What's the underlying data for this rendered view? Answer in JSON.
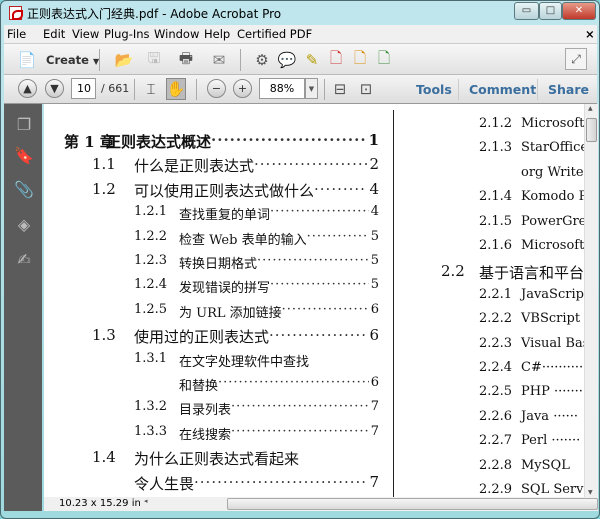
{
  "window": {
    "title": "正则表达式入门经典.pdf - Adobe Acrobat Pro"
  },
  "menu": [
    "File",
    "Edit",
    "View",
    "Plug-Ins",
    "Window",
    "Help",
    "Certified PDF"
  ],
  "toolbar": {
    "create_label": "Create"
  },
  "nav": {
    "page_current": "10",
    "page_total": "/ 661",
    "zoom": "88%",
    "tools": "Tools",
    "comment": "Comment",
    "share": "Share"
  },
  "status": {
    "page_size": "10.23 x 15.29 in"
  },
  "toc_left": [
    {
      "num": "第 1 章",
      "title": "正则表达式概述",
      "page": "1",
      "level": 0
    },
    {
      "num": "1.1",
      "title": "什么是正则表达式",
      "page": "2",
      "level": 1
    },
    {
      "num": "1.2",
      "title": "可以使用正则表达式做什么",
      "page": "4",
      "level": 1
    },
    {
      "num": "1.2.1",
      "title": "查找重复的单词",
      "page": "4",
      "level": 2
    },
    {
      "num": "1.2.2",
      "title": "检查 Web 表单的输入",
      "page": "5",
      "level": 2
    },
    {
      "num": "1.2.3",
      "title": "转换日期格式",
      "page": "5",
      "level": 2
    },
    {
      "num": "1.2.4",
      "title": "发现错误的拼写",
      "page": "5",
      "level": 2
    },
    {
      "num": "1.2.5",
      "title": "为 URL 添加链接",
      "page": "6",
      "level": 2
    },
    {
      "num": "1.3",
      "title": "使用过的正则表达式",
      "page": "6",
      "level": 1
    },
    {
      "num": "1.3.1",
      "title": "在文字处理软件中查找",
      "page": "",
      "level": 2
    },
    {
      "num": "",
      "title": "和替换",
      "page": "6",
      "level": 2
    },
    {
      "num": "1.3.2",
      "title": "目录列表",
      "page": "7",
      "level": 2
    },
    {
      "num": "1.3.3",
      "title": "在线搜索",
      "page": "7",
      "level": 2
    },
    {
      "num": "1.4",
      "title": "为什么正则表达式看起来",
      "page": "",
      "level": 1
    },
    {
      "num": "",
      "title": "令人生畏",
      "page": "7",
      "level": 1
    }
  ],
  "toc_right": [
    {
      "num": "2.1.2",
      "title": "Microsoft",
      "level": 2
    },
    {
      "num": "2.1.3",
      "title": "StarOffice",
      "level": 2
    },
    {
      "num": "",
      "title": "org Writer",
      "level": 2
    },
    {
      "num": "2.1.4",
      "title": "Komodo R",
      "level": 2
    },
    {
      "num": "2.1.5",
      "title": "PowerGrep",
      "level": 2
    },
    {
      "num": "2.1.6",
      "title": "Microsoft",
      "level": 2
    },
    {
      "num": "2.2",
      "title": "基于语言和平台",
      "level": 1
    },
    {
      "num": "2.2.1",
      "title": "JavaScript",
      "level": 2
    },
    {
      "num": "2.2.2",
      "title": "VBScript",
      "level": 2
    },
    {
      "num": "2.2.3",
      "title": "Visual Basic",
      "level": 2
    },
    {
      "num": "2.2.4",
      "title": "C#··········",
      "level": 2
    },
    {
      "num": "2.2.5",
      "title": "PHP ·······",
      "level": 2
    },
    {
      "num": "2.2.6",
      "title": "Java ······",
      "level": 2
    },
    {
      "num": "2.2.7",
      "title": "Perl ·······",
      "level": 2
    },
    {
      "num": "2.2.8",
      "title": "MySQL",
      "level": 2
    },
    {
      "num": "2.2.9",
      "title": "SQL Server",
      "level": 2
    }
  ]
}
